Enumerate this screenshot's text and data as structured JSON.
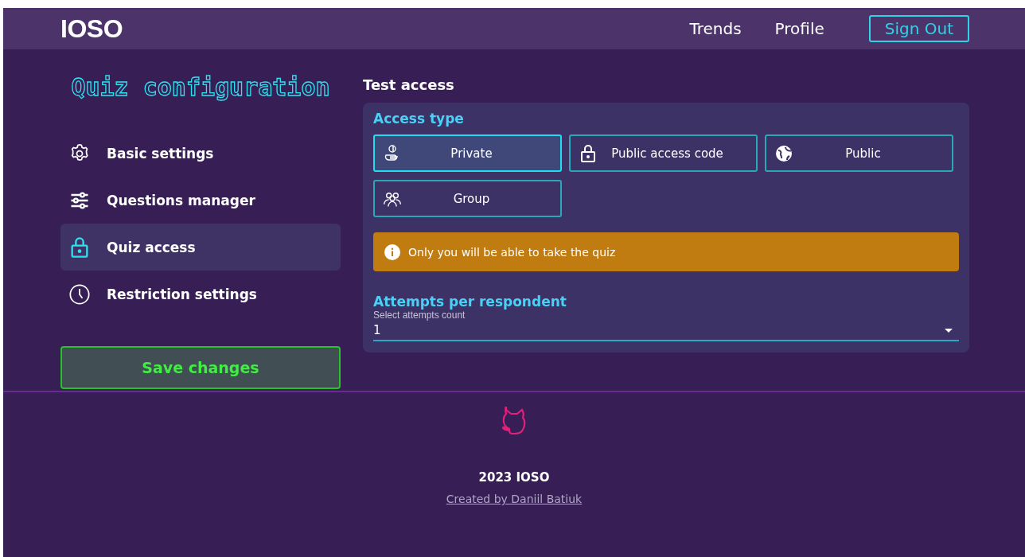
{
  "header": {
    "logo": "IOSO",
    "nav": [
      {
        "label": "Trends",
        "kind": "link"
      },
      {
        "label": "Profile",
        "kind": "link"
      },
      {
        "label": "Sign Out",
        "kind": "outlined"
      }
    ]
  },
  "sidebar": {
    "title": "Quiz configuration",
    "items": [
      {
        "label": "Basic settings",
        "kind": "gear",
        "selected": false
      },
      {
        "label": "Questions manager",
        "kind": "sliders",
        "selected": false
      },
      {
        "label": "Quiz access",
        "kind": "lock",
        "selected": true
      },
      {
        "label": "Restriction settings",
        "kind": "clock",
        "selected": false
      }
    ],
    "save_button": "Save changes"
  },
  "main": {
    "heading": "Test access",
    "access_type": {
      "title": "Access type",
      "options": [
        {
          "label": "Private",
          "kind": "hand",
          "selected": true
        },
        {
          "label": "Public access code",
          "kind": "lock",
          "selected": false
        },
        {
          "label": "Public",
          "kind": "globe",
          "selected": false
        },
        {
          "label": "Group",
          "kind": "people",
          "selected": false
        }
      ],
      "info": "Only you will be able to take the quiz"
    },
    "attempts": {
      "title": "Attempts per respondent",
      "label": "Select attempts count",
      "value": "1"
    }
  },
  "footer": {
    "copyright": "2023 IOSO",
    "credit": "Created by Daniil Batiuk"
  }
}
